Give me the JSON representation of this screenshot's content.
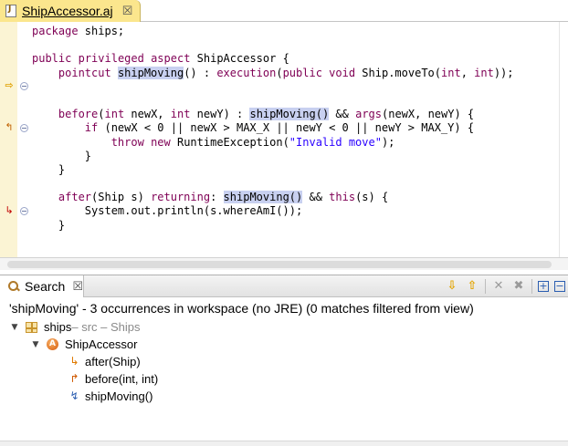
{
  "editor": {
    "tab_title": "ShipAccessor.aj",
    "tab_close": "☒",
    "lines": [
      [
        {
          "t": "kw",
          "v": "package"
        },
        {
          "t": "",
          "v": " ships;"
        }
      ],
      [],
      [
        {
          "t": "kw",
          "v": "public"
        },
        {
          "t": "",
          "v": " "
        },
        {
          "t": "kw",
          "v": "privileged"
        },
        {
          "t": "",
          "v": " "
        },
        {
          "t": "kw",
          "v": "aspect"
        },
        {
          "t": "",
          "v": " ShipAccessor {"
        }
      ],
      [
        {
          "t": "",
          "v": "    "
        },
        {
          "t": "kw",
          "v": "pointcut"
        },
        {
          "t": "",
          "v": " "
        },
        {
          "t": "hl",
          "v": "shipMoving"
        },
        {
          "t": "",
          "v": "() : "
        },
        {
          "t": "kw",
          "v": "execution"
        },
        {
          "t": "",
          "v": "("
        },
        {
          "t": "kw",
          "v": "public"
        },
        {
          "t": "",
          "v": " "
        },
        {
          "t": "kw",
          "v": "void"
        },
        {
          "t": "",
          "v": " Ship.moveTo("
        },
        {
          "t": "kw",
          "v": "int"
        },
        {
          "t": "",
          "v": ", "
        },
        {
          "t": "kw",
          "v": "int"
        },
        {
          "t": "",
          "v": "));"
        }
      ],
      [],
      [],
      [
        {
          "t": "",
          "v": "    "
        },
        {
          "t": "kw",
          "v": "before"
        },
        {
          "t": "",
          "v": "("
        },
        {
          "t": "kw",
          "v": "int"
        },
        {
          "t": "",
          "v": " newX, "
        },
        {
          "t": "kw",
          "v": "int"
        },
        {
          "t": "",
          "v": " newY) : "
        },
        {
          "t": "hl",
          "v": "shipMoving()"
        },
        {
          "t": "",
          "v": " && "
        },
        {
          "t": "kw",
          "v": "args"
        },
        {
          "t": "",
          "v": "(newX, newY) {"
        }
      ],
      [
        {
          "t": "",
          "v": "        "
        },
        {
          "t": "kw",
          "v": "if"
        },
        {
          "t": "",
          "v": " (newX < 0 || newX > MAX_X || newY < 0 || newY > MAX_Y) {"
        }
      ],
      [
        {
          "t": "",
          "v": "            "
        },
        {
          "t": "kw",
          "v": "throw"
        },
        {
          "t": "",
          "v": " "
        },
        {
          "t": "kw",
          "v": "new"
        },
        {
          "t": "",
          "v": " RuntimeException("
        },
        {
          "t": "str",
          "v": "\"Invalid move\""
        },
        {
          "t": "",
          "v": ");"
        }
      ],
      [
        {
          "t": "",
          "v": "        }"
        }
      ],
      [
        {
          "t": "",
          "v": "    }"
        }
      ],
      [],
      [
        {
          "t": "",
          "v": "    "
        },
        {
          "t": "kw",
          "v": "after"
        },
        {
          "t": "",
          "v": "(Ship s) "
        },
        {
          "t": "kw",
          "v": "returning"
        },
        {
          "t": "",
          "v": ": "
        },
        {
          "t": "hl",
          "v": "shipMoving()"
        },
        {
          "t": "",
          "v": " && "
        },
        {
          "t": "kw",
          "v": "this"
        },
        {
          "t": "",
          "v": "(s) {"
        }
      ],
      [
        {
          "t": "",
          "v": "        System.out.println(s.whereAmI());"
        }
      ],
      [
        {
          "t": "",
          "v": "    }"
        }
      ]
    ],
    "gutter_markers": {
      "pointcut": "⇨",
      "before": "↰",
      "after": "↳"
    }
  },
  "search": {
    "tab_title": "Search",
    "tab_close": "☒",
    "summary": "'shipMoving' - 3 occurrences in workspace (no JRE) (0 matches filtered from view)",
    "toolbar": {
      "next": "⇩",
      "prev": "⇧",
      "remove": "✕",
      "remove_all": "✖",
      "expand": "+",
      "collapse": "−"
    },
    "tree": {
      "package_name": "ships",
      "package_detail": " – src – Ships",
      "aspect_name": "ShipAccessor",
      "aspect_badge": "A",
      "members": [
        {
          "icon": "↳",
          "label": "after(Ship)"
        },
        {
          "icon": "↱",
          "label": "before(int, int)"
        },
        {
          "icon": "↯",
          "label": "shipMoving()"
        }
      ],
      "twisty": "▼"
    }
  }
}
